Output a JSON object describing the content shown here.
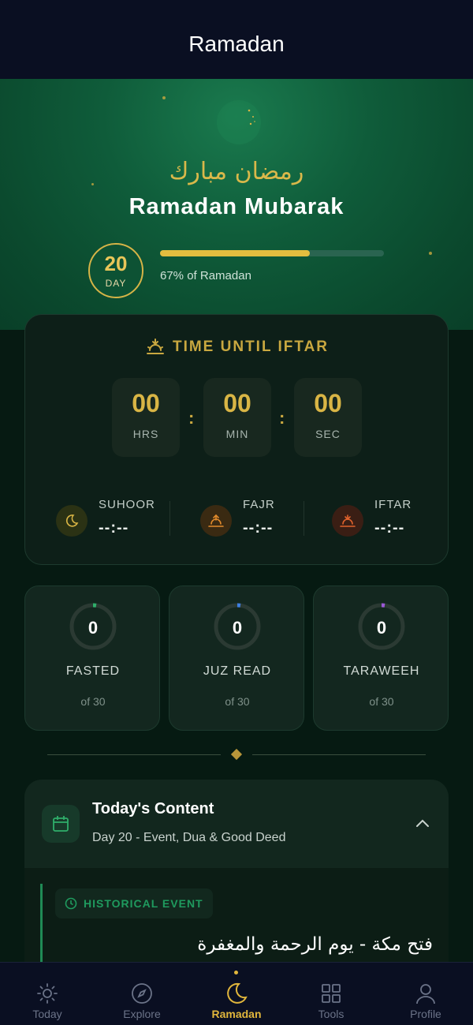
{
  "header": {
    "title": "Ramadan"
  },
  "hero": {
    "arabic_greeting": "رمضان مبارك",
    "title": "Ramadan Mubarak",
    "day_number": "20",
    "day_label": "DAY",
    "progress_fraction": 0.67,
    "progress_text": "67% of Ramadan"
  },
  "iftar": {
    "heading": "TIME UNTIL IFTAR",
    "hours": "00",
    "hours_label": "HRS",
    "minutes": "00",
    "minutes_label": "MIN",
    "seconds": "00",
    "seconds_label": "SEC",
    "separator": ":",
    "prayers": [
      {
        "name": "SUHOOR",
        "time": "--:--",
        "icon": "moon-icon"
      },
      {
        "name": "FAJR",
        "time": "--:--",
        "icon": "sunrise-icon"
      },
      {
        "name": "IFTAR",
        "time": "--:--",
        "icon": "sunset-icon"
      }
    ]
  },
  "stats": [
    {
      "value": "0",
      "label": "FASTED",
      "of": "of 30",
      "accent": "#2fae6a"
    },
    {
      "value": "0",
      "label": "JUZ READ",
      "of": "of 30",
      "accent": "#3f7fe0"
    },
    {
      "value": "0",
      "label": "TARAWEEH",
      "of": "of 30",
      "accent": "#9b59d6"
    }
  ],
  "content": {
    "title": "Today's Content",
    "subtitle": "Day 20 - Event, Dua & Good Deed",
    "tag": "HISTORICAL EVENT",
    "event_arabic": "فتح مكة - يوم الرحمة والمغفرة"
  },
  "nav": [
    {
      "label": "Today",
      "icon": "sun-icon",
      "active": false
    },
    {
      "label": "Explore",
      "icon": "compass-icon",
      "active": false
    },
    {
      "label": "Ramadan",
      "icon": "crescent-icon",
      "active": true
    },
    {
      "label": "Tools",
      "icon": "grid-icon",
      "active": false
    },
    {
      "label": "Profile",
      "icon": "user-icon",
      "active": false
    }
  ],
  "colors": {
    "gold": "#e1b63c",
    "green": "#0f5c3a",
    "navy": "#0a0f22"
  }
}
